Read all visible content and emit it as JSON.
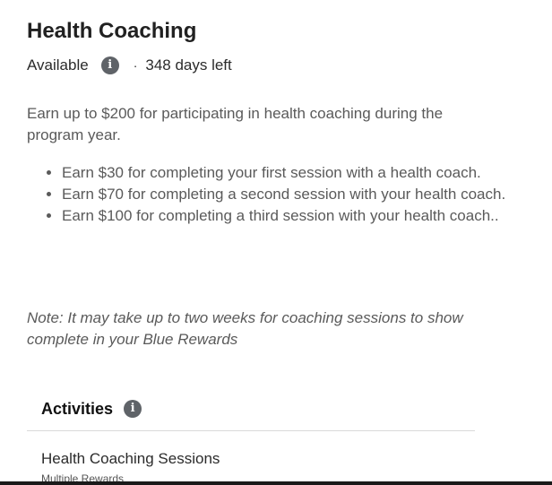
{
  "header": {
    "title": "Health Coaching",
    "status": "Available",
    "separator": "·",
    "days_left": "348 days left",
    "info_glyph": "i"
  },
  "body": {
    "description": "Earn up to $200 for participating in health coaching during the program year.",
    "bullets": [
      "Earn $30 for completing your first session with a health coach.",
      "Earn $70 for completing a second session with your health coach.",
      "Earn $100 for completing a third session with your health coach.."
    ],
    "note": "Note: It may take up to two weeks for coaching sessions to show complete in your Blue Rewards"
  },
  "activities": {
    "heading": "Activities",
    "items": [
      {
        "title": "Health Coaching Sessions",
        "subtitle": "Multiple Rewards"
      }
    ]
  },
  "icons": {
    "status_info": "info-icon",
    "activities_info": "info-icon"
  },
  "colors": {
    "info_icon_bg": "#5f6368",
    "body_text": "#5a5a5a",
    "title_text": "#212121"
  }
}
